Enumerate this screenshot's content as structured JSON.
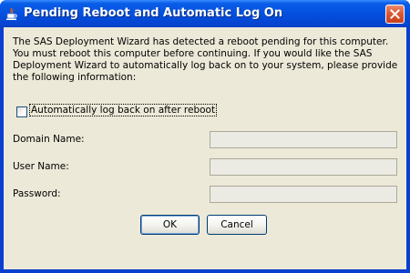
{
  "window": {
    "title": "Pending Reboot and Automatic Log On",
    "title_icon": "java-cup-icon",
    "close_icon": "close-icon"
  },
  "message": "The SAS Deployment Wizard has detected a reboot pending for this computer. You must reboot this computer before continuing. If you would like the SAS Deployment Wizard to automatically log back on to your system, please provide the following information:",
  "auto_logon": {
    "label": "Automatically log back on after reboot",
    "checked": false
  },
  "fields": [
    {
      "label": "Domain Name:",
      "value": ""
    },
    {
      "label": "User Name:",
      "value": ""
    },
    {
      "label": "Password:",
      "value": ""
    }
  ],
  "buttons": {
    "ok_label": "OK",
    "cancel_label": "Cancel"
  },
  "colors": {
    "titlebar": "#0552e0",
    "dialog_bg": "#ece9d8",
    "close_button": "#d9552f"
  }
}
